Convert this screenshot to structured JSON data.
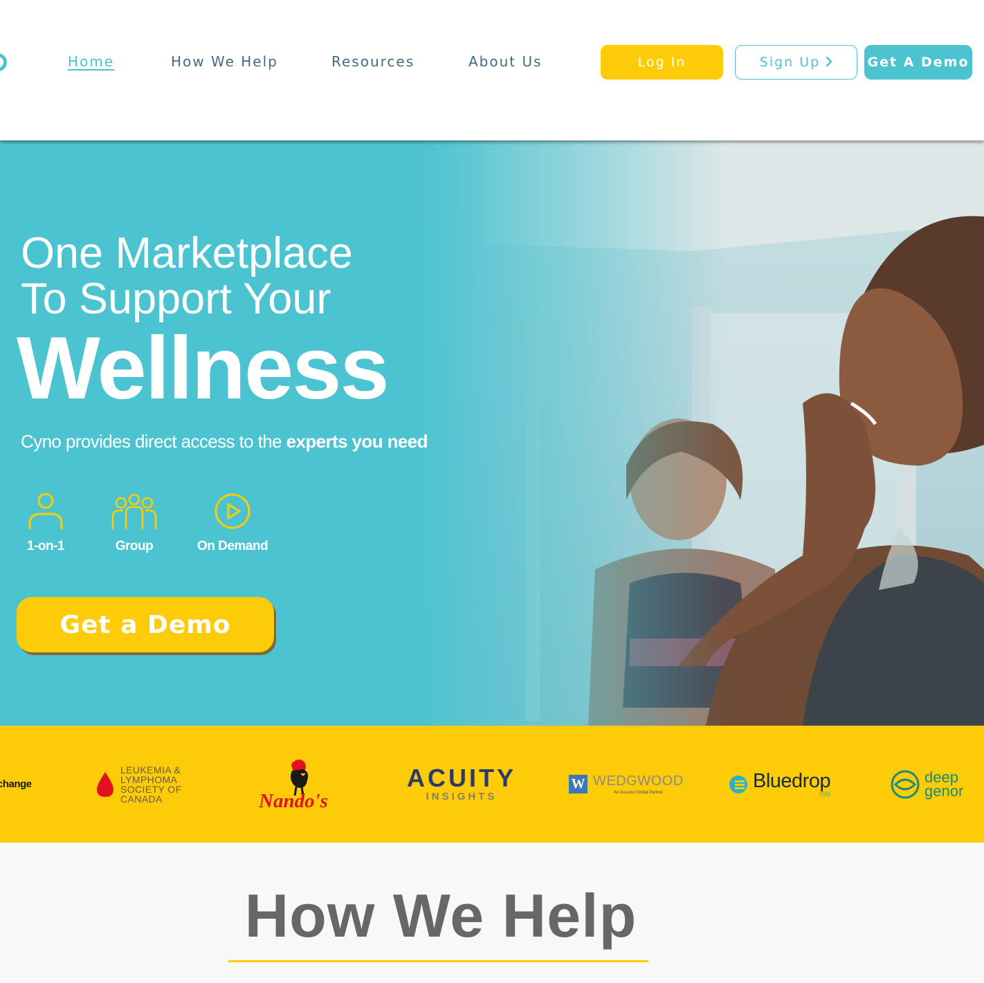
{
  "nav": {
    "items": [
      {
        "label": "Home",
        "active": true
      },
      {
        "label": "How We Help",
        "active": false
      },
      {
        "label": "Resources",
        "active": false
      },
      {
        "label": "About Us",
        "active": false
      }
    ],
    "login_label": "Log In",
    "signup_label": "Sign Up",
    "signup_icon": "chevron-right-icon",
    "demo_label": "Get A Demo"
  },
  "hero": {
    "line1": "One Marketplace",
    "line2": "To Support Your",
    "headline": "Wellness",
    "subtitle_prefix": "Cyno provides direct access to the ",
    "subtitle_bold": "experts you need",
    "features": [
      {
        "label": "1-on-1",
        "icon": "person-icon"
      },
      {
        "label": "Group",
        "icon": "group-icon"
      },
      {
        "label": "On Demand",
        "icon": "play-icon"
      }
    ],
    "cta_label": "Get a Demo"
  },
  "partners": {
    "change": "change",
    "lls": "LEUKEMIA &\nLYMPHOMA\nSOCIETY OF\nCANADA",
    "nandos": "Nando's",
    "acuity_main": "ACUITY",
    "acuity_sub": "INSIGHTS",
    "wedgwood": "WEDGWOOD",
    "wedgwood_mark": "W",
    "wedgwood_tag": "An Assurex Global Partner",
    "bluedrop": "Bluedrop",
    "bluedrop_sub": "ISM",
    "deep_line1": "deep",
    "deep_line2": "genor"
  },
  "help": {
    "title": "How We Help"
  },
  "colors": {
    "teal": "#4cc3d0",
    "yellow": "#fccc08",
    "nav_text": "#3d6d7e",
    "heading_gray": "#676767"
  }
}
